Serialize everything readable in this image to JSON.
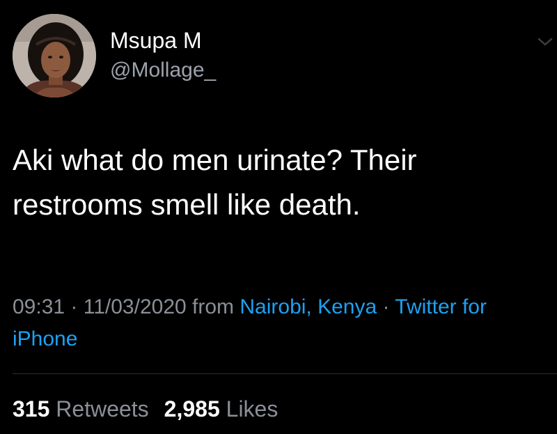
{
  "user": {
    "name": "Msupa M",
    "handle": "@Mollage_"
  },
  "tweet": {
    "text": "Aki what do men urinate? Their restrooms smell like death."
  },
  "meta": {
    "time": "09:31",
    "date": "11/03/2020",
    "from_label": "from",
    "location": "Nairobi, Kenya",
    "separator": "·",
    "source": "Twitter for iPhone"
  },
  "stats": {
    "retweets_count": "315",
    "retweets_label": "Retweets",
    "likes_count": "2,985",
    "likes_label": "Likes"
  },
  "icons": {
    "menu": "chevron-down-icon"
  },
  "colors": {
    "background": "#000000",
    "text": "#ffffff",
    "secondary": "#8a9097",
    "link": "#1da1f2",
    "divider": "#2a2f33"
  }
}
